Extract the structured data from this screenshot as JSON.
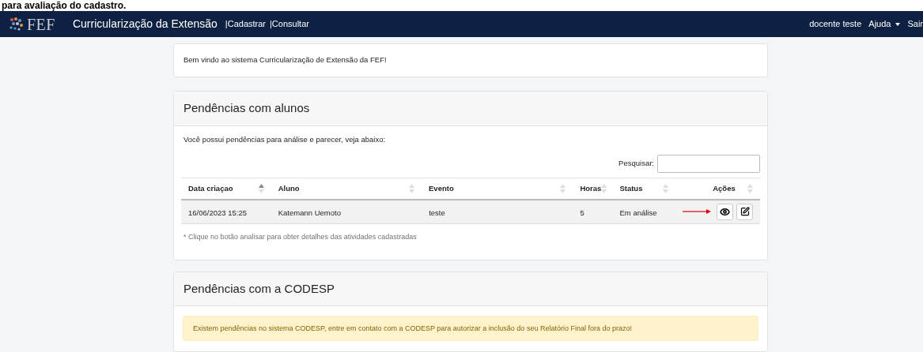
{
  "caption": "para avaliação do cadastro.",
  "navbar": {
    "logo_text": "FEF",
    "title": "Curricularização da Extensão",
    "links": [
      "|Cadastrar",
      "|Consultar"
    ],
    "user": "docente teste",
    "menus": [
      {
        "label": "Ajuda",
        "dropdown": true
      },
      {
        "label": "Sair",
        "dropdown": false
      }
    ]
  },
  "welcome": "Bem vindo ao sistema Curricularização de Extensão da FEF!",
  "pending_students": {
    "title": "Pendências com alunos",
    "intro": "Você possui pendências para análise e parecer, veja abaixo:",
    "search": {
      "label": "Pesquisar:"
    },
    "columns": [
      {
        "label": "Data criaçao",
        "sorted": true
      },
      {
        "label": "Aluno",
        "sorted": false
      },
      {
        "label": "Evento",
        "sorted": false
      },
      {
        "label": "Horas",
        "sorted": false
      },
      {
        "label": "Status",
        "sorted": false
      },
      {
        "label": "Ações",
        "sorted": false
      }
    ],
    "rows": [
      {
        "cells": [
          "16/06/2023 15:25",
          "Katemann Uemoto",
          "teste",
          "5",
          "Em análise"
        ],
        "actions": [
          {
            "kind": "view"
          },
          {
            "kind": "edit"
          }
        ],
        "pointer_arrow": true
      }
    ],
    "note": "* Clique no botão analisar para obter detalhes das atividades cadastradas"
  },
  "pending_codesp": {
    "title": "Pendências com a CODESP",
    "alert": "Existem pendências no sistema CODESP, entre em contato com a CODESP para autorizar a inclusão do seu Relatório Final fora do prazo!"
  }
}
